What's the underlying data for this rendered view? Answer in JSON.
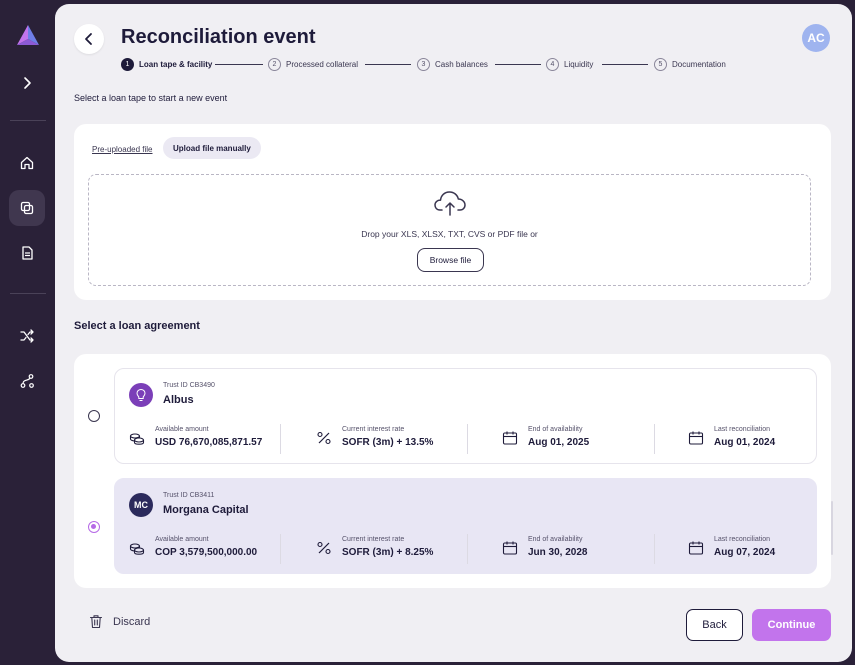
{
  "page": {
    "title": "Reconciliation event",
    "user_initials": "AC",
    "instruction": "Select a loan tape to start a new event"
  },
  "stepper": [
    {
      "num": "1",
      "label": "Loan tape & facility",
      "current": true
    },
    {
      "num": "2",
      "label": "Processed collateral",
      "current": false
    },
    {
      "num": "3",
      "label": "Cash balances",
      "current": false
    },
    {
      "num": "4",
      "label": "Liquidity",
      "current": false
    },
    {
      "num": "5",
      "label": "Documentation",
      "current": false
    }
  ],
  "upload": {
    "tab_preuploaded": "Pre-uploaded file",
    "tab_manual": "Upload file manually",
    "drop_text": "Drop your  XLS, XLSX, TXT, CVS or PDF file or",
    "browse_label": "Browse file"
  },
  "agreements": {
    "section_title": "Select a loan agreement",
    "items": [
      {
        "trust_id": "Trust ID CB3490",
        "name": "Albus",
        "avatar": "",
        "selected": false,
        "available_label": "Available amount",
        "available_value": "USD 76,670,085,871.57",
        "rate_label": "Current interest rate",
        "rate_value": "SOFR (3m) + 13.5%",
        "end_label": "End of availability",
        "end_value": "Aug 01, 2025",
        "last_label": "Last reconciliation",
        "last_value": "Aug 01, 2024"
      },
      {
        "trust_id": "Trust ID CB3411",
        "name": "Morgana Capital",
        "avatar": "MC",
        "selected": true,
        "available_label": "Available amount",
        "available_value": "COP 3,579,500,000.00",
        "rate_label": "Current interest rate",
        "rate_value": "SOFR (3m) + 8.25%",
        "end_label": "End of availability",
        "end_value": "Jun 30, 2028",
        "last_label": "Last reconciliation",
        "last_value": "Aug 07, 2024"
      }
    ]
  },
  "footer": {
    "discard_label": "Discard",
    "back_label": "Back",
    "continue_label": "Continue"
  },
  "colors": {
    "sidebar": "#2a2138",
    "accent": "#c274ec",
    "selected_row": "#e8e6f4",
    "avatar_user": "#9fb4ef"
  },
  "icons": {
    "sidebar": [
      "logo-icon",
      "chevron-right-icon",
      "home-icon",
      "layers-icon",
      "document-icon",
      "shuffle-icon",
      "route-icon"
    ],
    "metrics": [
      "coins-icon",
      "percent-icon",
      "calendar-icon",
      "calendar-icon"
    ]
  }
}
